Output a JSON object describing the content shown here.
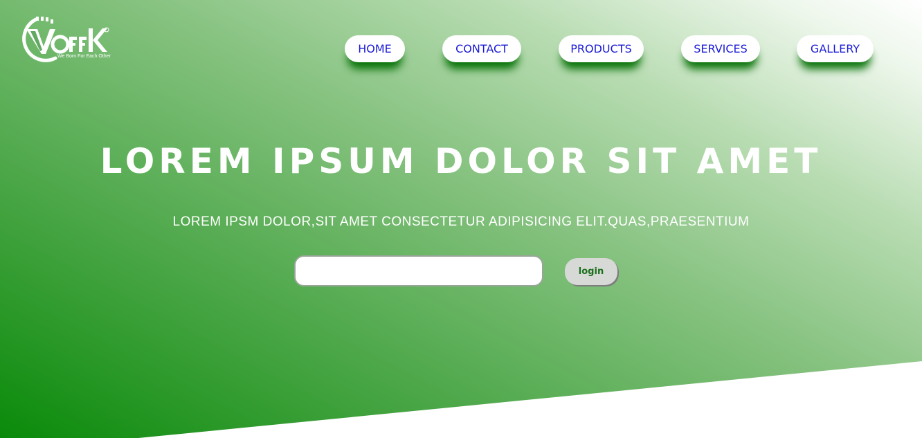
{
  "logo": {
    "wordmark": "VOrrK",
    "tagline": "We Born For Each Other",
    "registered_mark": "®"
  },
  "nav": {
    "items": [
      {
        "label": "HOME"
      },
      {
        "label": "CONTACT"
      },
      {
        "label": "PRODUCTS"
      },
      {
        "label": "SERVICES"
      },
      {
        "label": "GALLERY"
      }
    ]
  },
  "hero": {
    "headline": "LOREM IPSUM DOLOR SIT AMET",
    "subline": "LOREM IPSM DOLOR,SIT AMET CONSECTETUR ADIPISICING ELIT.QUAS,PRAESENTIUM"
  },
  "login": {
    "input_value": "",
    "input_placeholder": "",
    "button_label": "login"
  },
  "colors": {
    "nav_text": "#1a1ad6",
    "nav_shadow": "#006e00",
    "hero_gradient_dark": "#0a8a0a",
    "hero_gradient_light": "#ffffff",
    "login_button_bg": "#d6d9d6",
    "login_button_text": "#1b6e1b"
  }
}
